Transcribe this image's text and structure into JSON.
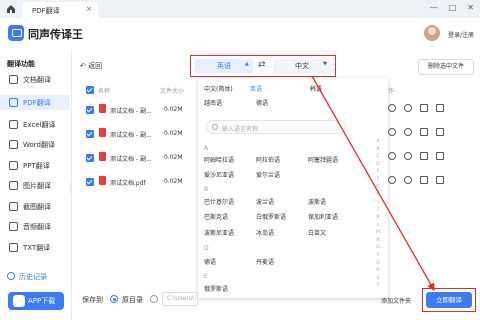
{
  "titlebar": {
    "tab_title": "PDF翻译",
    "tab_close": "×"
  },
  "header": {
    "app_name": "同声传译王",
    "login": "登录/注册"
  },
  "sidebar": {
    "title": "翻译功能",
    "items": [
      {
        "label": "文档翻译",
        "active": false
      },
      {
        "label": "PDF翻译",
        "active": true
      },
      {
        "label": "Excel翻译",
        "active": false
      },
      {
        "label": "Word翻译",
        "active": false
      },
      {
        "label": "PPT翻译",
        "active": false
      },
      {
        "label": "图片翻译",
        "active": false
      },
      {
        "label": "截图翻译",
        "active": false
      },
      {
        "label": "音频翻译",
        "active": false
      },
      {
        "label": "TXT翻译",
        "active": false
      }
    ],
    "history": "历史记录",
    "app_download": "APP下载"
  },
  "toolbar": {
    "back": "返回",
    "source_lang": "英语",
    "target_lang": "中文",
    "delete_selected": "删除选中文件"
  },
  "table": {
    "headers": {
      "name": "名称",
      "size": "文件大小",
      "ops": "操作"
    },
    "rows": [
      {
        "name": "测试文档 - 副...",
        "size": "0.02M"
      },
      {
        "name": "测试文档 - 副...",
        "size": "0.02M"
      },
      {
        "name": "测试文档 - 副...",
        "size": "0.02M"
      },
      {
        "name": "测试文档.pdf",
        "size": "0.02M"
      }
    ]
  },
  "dropdown": {
    "top_options": [
      "中文(简体)",
      "英语",
      "韩语",
      "越南语",
      "德语"
    ],
    "search_placeholder": "输入语言名称",
    "groups": [
      {
        "letter": "A",
        "langs": [
          "阿姆哈拉语",
          "阿拉伯语",
          "阿塞拜疆语",
          "爱沙尼亚语",
          "爱尔兰语"
        ]
      },
      {
        "letter": "B",
        "langs": [
          "巴什基尔语",
          "波兰语",
          "波斯语",
          "巴斯克语",
          "白俄罗斯语",
          "保加利亚语",
          "波斯尼亚语",
          "冰岛语",
          "白苗文"
        ]
      },
      {
        "letter": "D",
        "langs": [
          "德语",
          "丹麦语"
        ]
      },
      {
        "letter": "E",
        "langs": [
          "俄罗斯语"
        ]
      }
    ],
    "alphabet": [
      "A",
      "B",
      "C",
      "D",
      "E",
      "F",
      "G",
      "H",
      "I",
      "J",
      "K",
      "L",
      "M",
      "N",
      "O",
      "P",
      "Q",
      "R",
      "S",
      "T"
    ]
  },
  "footer": {
    "save_to": "保存到",
    "option_original": "原目录",
    "path_placeholder": "C:\\Users\\",
    "add_folder": "添加文件夹",
    "translate_button": "立即翻译"
  },
  "colors": {
    "accent": "#3b7cf6",
    "annotation_red": "#d9302b"
  }
}
